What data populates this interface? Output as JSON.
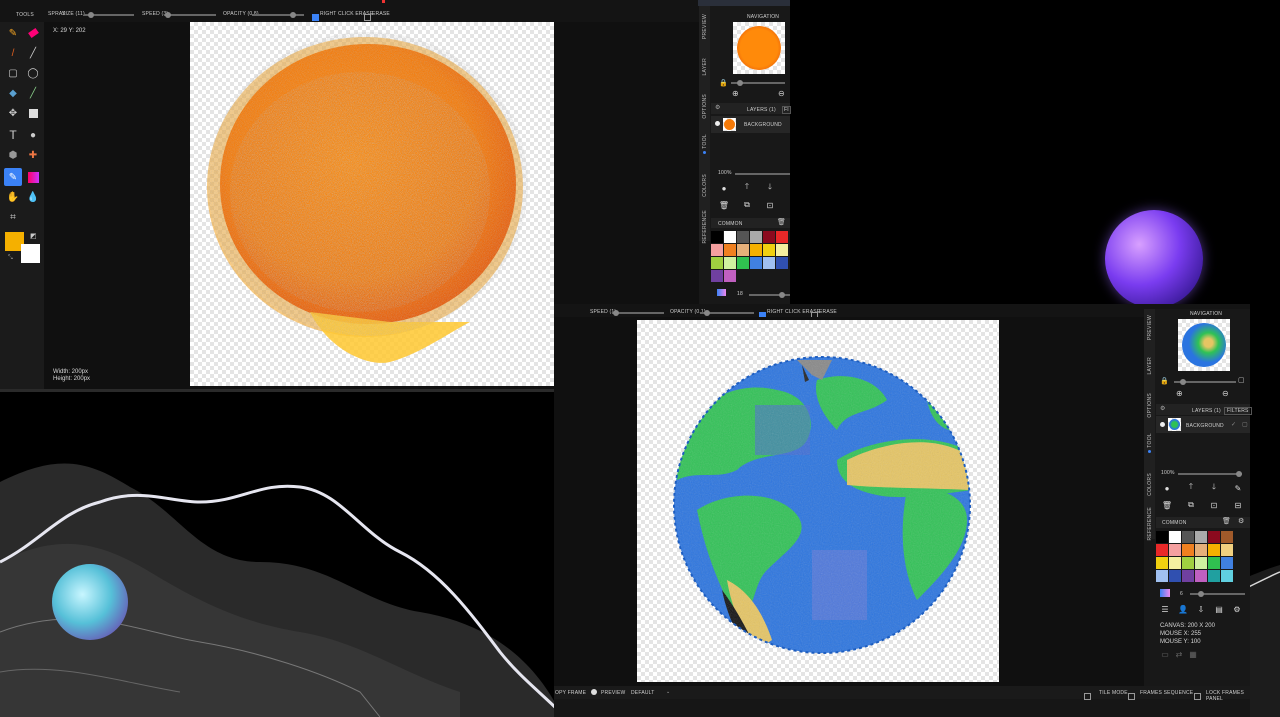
{
  "window1": {
    "tools_title": "TOOLS",
    "tool_label": "SPRAY:",
    "size": "SIZE (11)",
    "speed": "SPEED (3)",
    "opacity": "OPACITY (0.8)",
    "right_click_erase": "RIGHT CLICK ERASE",
    "erase": "ERASE",
    "coords": "X: 29 Y: 202",
    "width": "Width: 200px",
    "height": "Height: 200px",
    "tabs": [
      "PREVIEW",
      "LAYER",
      "OPTIONS",
      "TOOL",
      "COLORS",
      "REFERENCE"
    ],
    "navigation": "NAVIGATION",
    "layers": "LAYERS (1)",
    "filters": "FI",
    "layer_name": "BACKGROUND",
    "zoom": "100%",
    "palette_name": "COMMON",
    "brush_size": "18",
    "colors": {
      "primary": "#f5b000",
      "secondary": "#ffffff",
      "accent": "#3b82f6"
    }
  },
  "window2": {
    "speed": "SPEED (1)",
    "opacity": "OPACITY (0.1)",
    "right_click_erase": "RIGHT CLICK ERASE",
    "erase": "ERASE",
    "tabs": [
      "PREVIEW",
      "LAYER",
      "OPTIONS",
      "TOOL",
      "COLORS",
      "REFERENCE"
    ],
    "navigation": "NAVIGATION",
    "layers": "LAYERS (1)",
    "filters": "FILTERS",
    "layer_name": "BACKGROUND",
    "zoom": "100%",
    "palette_name": "COMMON",
    "brush_size": "6",
    "canvas": "CANVAS: 200 X 200",
    "mouse_x": "MOUSE X: 255",
    "mouse_y": "MOUSE Y: 100",
    "copy_frame": "OPY FRAME",
    "preview": "PREVIEW",
    "default": "DEFAULT",
    "tile_mode": "TILE MODE",
    "frames_sequence": "FRAMES SEQUENCE",
    "lock_frames_panel": "LOCK FRAMES PANEL"
  },
  "palette1": [
    "#000000",
    "#ffffff",
    "#555555",
    "#aaaaaa",
    "#8b0a1e",
    "#e82828",
    "#f5a0a0",
    "#f08020",
    "#e6b07a",
    "#f5b000",
    "#f0d010",
    "#f5f0a0",
    "#a0d040",
    "#d0f0a0",
    "#30c050",
    "#4080e0",
    "#a0c0f0",
    "#3050b0",
    "#7040a0",
    "#c060c0"
  ],
  "palette2": [
    "#000000",
    "#ffffff",
    "#555555",
    "#aaaaaa",
    "#8b0a1e",
    "#a05a2a",
    "#e82828",
    "#f5a0a0",
    "#f08020",
    "#e6b07a",
    "#f5b000",
    "#f0d080",
    "#f0d010",
    "#f5f0a0",
    "#a0d040",
    "#d0f0a0",
    "#30c050",
    "#4080e0",
    "#a0c0f0",
    "#3050b0",
    "#7040a0",
    "#c060c0",
    "#20a0a0",
    "#60d0e0"
  ]
}
